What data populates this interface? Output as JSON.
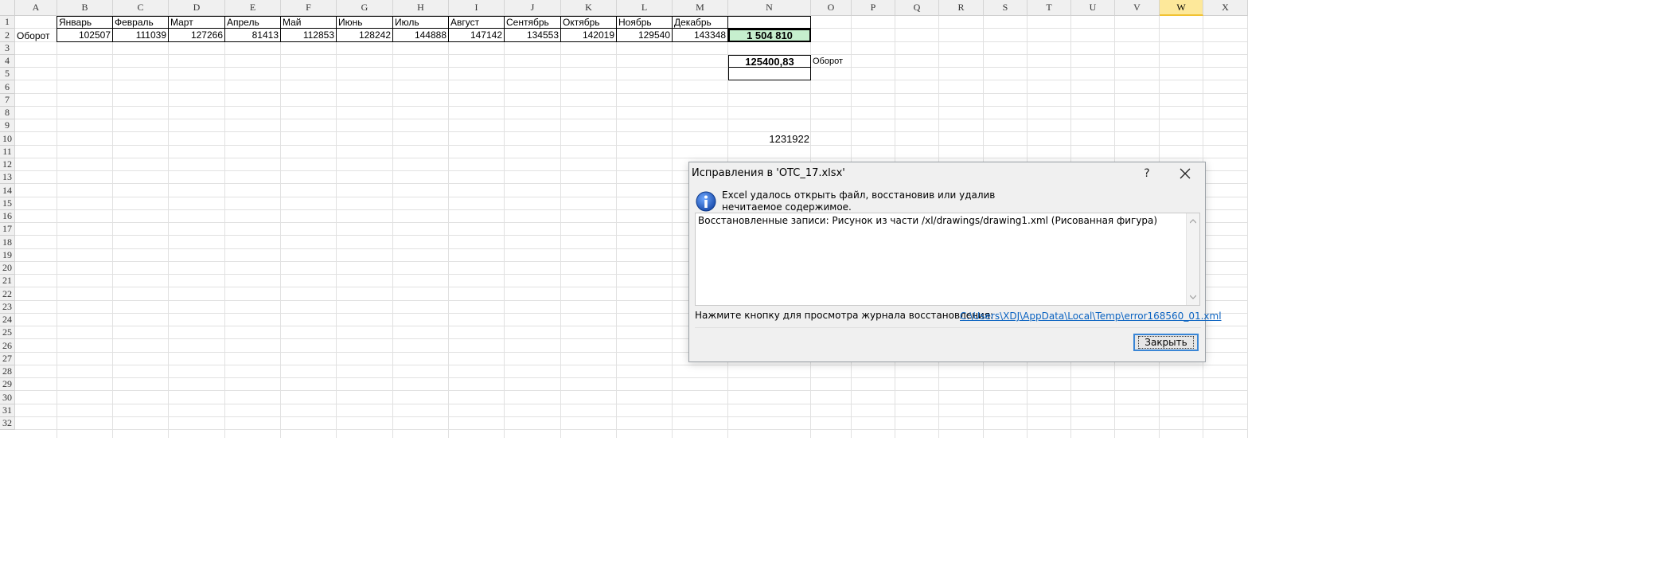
{
  "sheet": {
    "columns": [
      "A",
      "B",
      "C",
      "D",
      "E",
      "F",
      "G",
      "H",
      "I",
      "J",
      "K",
      "L",
      "M",
      "N",
      "O",
      "P",
      "Q",
      "R",
      "S",
      "T",
      "U",
      "V",
      "W",
      "X"
    ],
    "selected_column": "W",
    "row_numbers": [
      "1",
      "2",
      "3",
      "4",
      "5",
      "6",
      "7",
      "8",
      "9",
      "10",
      "11",
      "12",
      "13",
      "14",
      "15",
      "16",
      "17",
      "18",
      "19",
      "20",
      "21",
      "22",
      "23",
      "24",
      "25",
      "26",
      "27",
      "28",
      "29",
      "30",
      "31",
      "32"
    ],
    "months": [
      "Январь",
      "Февраль",
      "Март",
      "Апрель",
      "Май",
      "Июнь",
      "Июль",
      "Август",
      "Сентябрь",
      "Октябрь",
      "Ноябрь",
      "Декабрь"
    ],
    "row2_label": "Оборот",
    "row2_values": [
      "102507",
      "111039",
      "127266",
      "81413",
      "112853",
      "128242",
      "144888",
      "147142",
      "134553",
      "142019",
      "129540",
      "143348"
    ],
    "total": "1 504 810",
    "total_fill": "#c6efce",
    "average": "125400,83",
    "average_label": "Оборот",
    "n10_value": "1231922"
  },
  "dialog": {
    "title": "Исправления в 'OTC_17.xlsx'",
    "help": "?",
    "message": "Excel удалось открыть файл, восстановив или удалив нечитаемое содержимое.",
    "details": "Восстановленные записи: Рисунок из части /xl/drawings/drawing1.xml (Рисованная фигура)",
    "log_label": "Нажмите кнопку для просмотра журнала восстановления:",
    "log_link": "C:\\Users\\XDJ\\AppData\\Local\\Temp\\error168560_01.xml",
    "close_button": "Закрыть",
    "icon": "info-icon",
    "link_color": "#0b63c1",
    "button_focus_color": "#3a86d6"
  }
}
